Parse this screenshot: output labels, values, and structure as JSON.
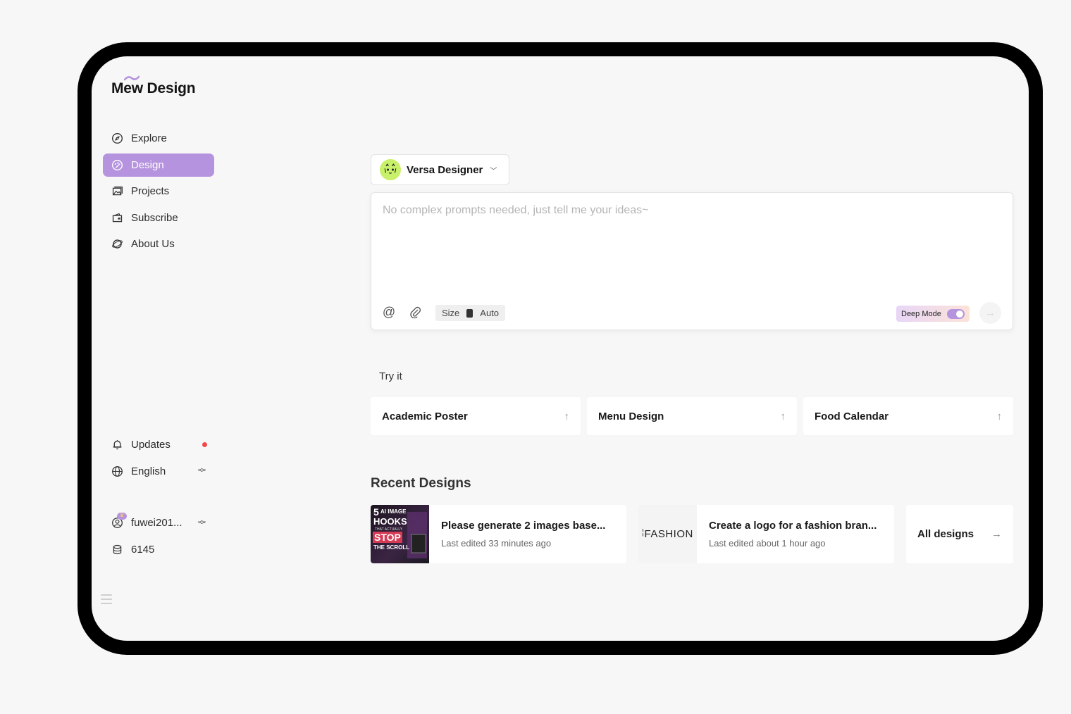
{
  "app": {
    "logo": "Mew Design"
  },
  "sidebar": {
    "items": [
      {
        "label": "Explore",
        "icon": "compass-icon"
      },
      {
        "label": "Design",
        "icon": "palette-icon",
        "active": true
      },
      {
        "label": "Projects",
        "icon": "gallery-icon"
      },
      {
        "label": "Subscribe",
        "icon": "wallet-icon"
      },
      {
        "label": "About Us",
        "icon": "planet-icon"
      }
    ],
    "updates_label": "Updates",
    "language_label": "English",
    "username": "fuwei201...",
    "credits": "6145"
  },
  "agent": {
    "name": "Versa Designer"
  },
  "prompt": {
    "placeholder": "No complex prompts needed, just tell me your ideas~",
    "size_label": "Size",
    "size_value": "Auto",
    "deep_mode_label": "Deep Mode",
    "deep_mode_on": true
  },
  "try_it": {
    "label": "Try it",
    "cards": [
      "Academic Poster",
      "Menu Design",
      "Food Calendar"
    ]
  },
  "recent": {
    "title": "Recent Designs",
    "items": [
      {
        "title": "Please generate 2 images base...",
        "subtitle": "Last edited 33 minutes ago",
        "thumb_text": [
          "5",
          "AI IMAGE",
          "HOOKS",
          "THAT ACTUALLY",
          "STOP",
          "THE SCROLL"
        ]
      },
      {
        "title": "Create a logo for a fashion bran...",
        "subtitle": "Last edited about 1 hour ago",
        "thumb_text": [
          "FASHION"
        ]
      }
    ],
    "all_label": "All designs"
  },
  "colors": {
    "accent": "#b593de",
    "notification": "#ef4b4b",
    "agent_avatar": "#c8f06a"
  }
}
